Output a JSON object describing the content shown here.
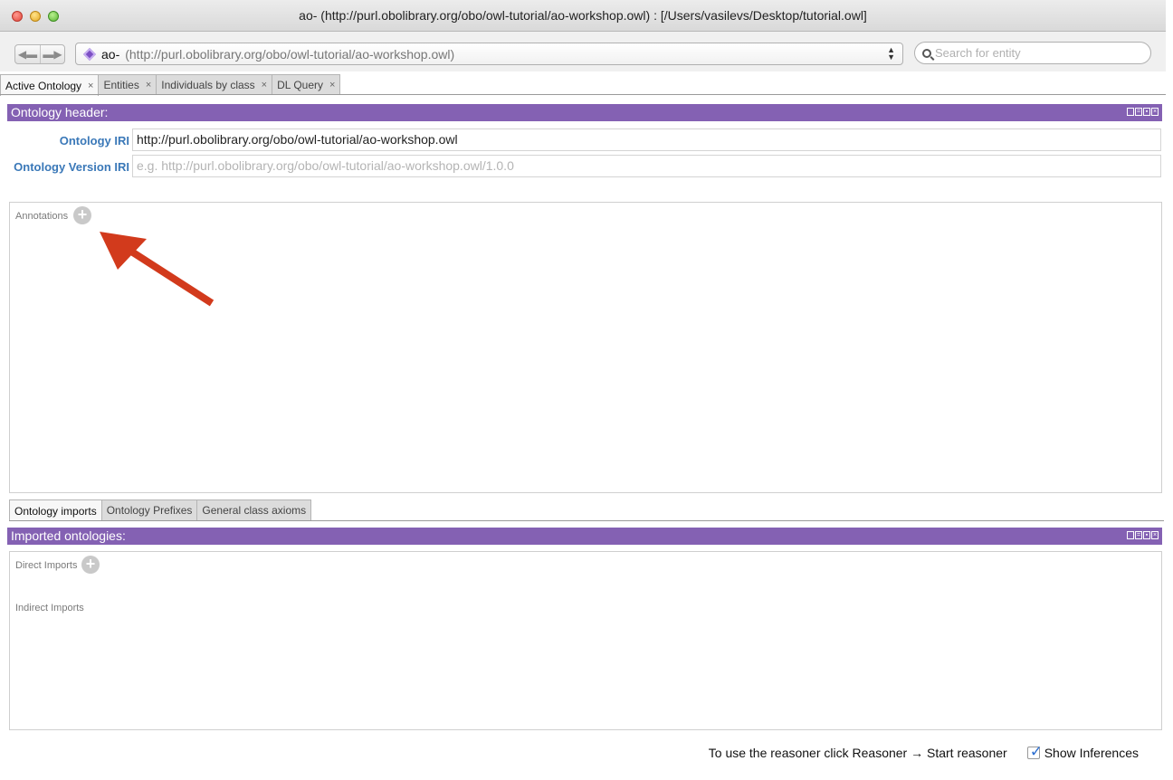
{
  "window": {
    "title": "ao- (http://purl.obolibrary.org/obo/owl-tutorial/ao-workshop.owl)  : [/Users/vasilevs/Desktop/tutorial.owl]"
  },
  "toolbar": {
    "back_icon": "back-arrow-icon",
    "forward_icon": "forward-arrow-icon",
    "ontology_name": "ao-",
    "ontology_iri": "(http://purl.obolibrary.org/obo/owl-tutorial/ao-workshop.owl)",
    "search_placeholder": "Search for entity"
  },
  "tabs": [
    {
      "label": "Active Ontology",
      "close": "×",
      "active": true
    },
    {
      "label": "Entities",
      "close": "×"
    },
    {
      "label": "Individuals by class",
      "close": "×"
    },
    {
      "label": "DL Query",
      "close": "×"
    }
  ],
  "ontology_header": {
    "title": "Ontology header:",
    "iri_label": "Ontology IRI",
    "iri_value": "http://purl.obolibrary.org/obo/owl-tutorial/ao-workshop.owl",
    "version_iri_label": "Ontology Version IRI",
    "version_iri_placeholder": "e.g. http://purl.obolibrary.org/obo/owl-tutorial/ao-workshop.owl/1.0.0",
    "annotations_label": "Annotations",
    "add_symbol": "+"
  },
  "bottom_tabs": [
    {
      "label": "Ontology imports",
      "active": true
    },
    {
      "label": "Ontology Prefixes"
    },
    {
      "label": "General class axioms"
    }
  ],
  "imported_ontologies": {
    "title": "Imported ontologies:",
    "direct_label": "Direct Imports",
    "indirect_label": "Indirect Imports",
    "add_symbol": "+"
  },
  "status_bar": {
    "reasoner_hint": "To use the reasoner click Reasoner → Start reasoner",
    "show_inferences_label": "Show Inferences",
    "show_inferences_checked": true
  },
  "colors": {
    "view_header": "#8461b3",
    "field_label": "#3a78b8",
    "annotation_arrow": "#d23a1c"
  }
}
